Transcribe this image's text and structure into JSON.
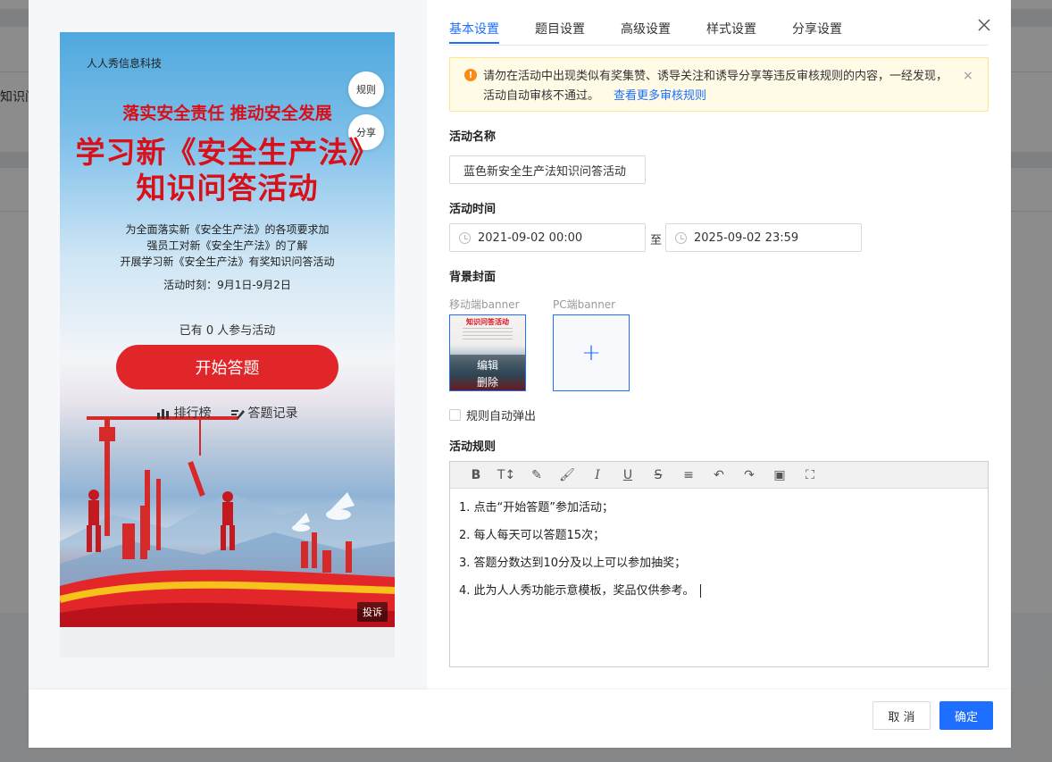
{
  "background": {
    "partial_text": "知识问"
  },
  "tabs": [
    {
      "label": "基本设置",
      "active": true
    },
    {
      "label": "题目设置"
    },
    {
      "label": "高级设置"
    },
    {
      "label": "样式设置"
    },
    {
      "label": "分享设置"
    }
  ],
  "close_icon": "close-icon",
  "notice": {
    "icon": "warning-icon",
    "text": "请勿在活动中出现类似有奖集赞、诱导关注和诱导分享等违反审核规则的内容，一经发现，活动自动审核不通过。",
    "link": "查看更多审核规则",
    "close": "×"
  },
  "form": {
    "name_label": "活动名称",
    "name_value": "蓝色新安全生产法知识问答活动",
    "time_label": "活动时间",
    "start_time": "2021-09-02 00:00",
    "to": "至",
    "end_time": "2025-09-02 23:59",
    "cover_label": "背景封面",
    "mobile_banner_label": "移动端banner",
    "pc_banner_label": "PC端banner",
    "thumb_title": "知识问答活动",
    "edit": "编辑",
    "delete": "删除",
    "upload_plus": "+",
    "auto_popup_label": "规则自动弹出",
    "auto_popup_checked": false,
    "rules_label": "活动规则"
  },
  "editor": {
    "toolbar": [
      "bold-icon",
      "font-size-icon",
      "highlight-icon",
      "brush-icon",
      "italic-icon",
      "underline-icon",
      "strikethrough-icon",
      "align-icon",
      "undo-icon",
      "redo-icon",
      "image-icon",
      "fullscreen-icon"
    ],
    "lines": [
      "1. 点击“开始答题”参加活动；",
      "2. 每人每天可以答题15次；",
      "3. 答题分数达到10分及以上可以参加抽奖；",
      "4. 此为人人秀功能示意模板，奖品仅供参考。"
    ]
  },
  "preview": {
    "company": "人人秀信息科技",
    "rules_btn": "规则",
    "share_btn": "分享",
    "slogan": "落实安全责任  推动安全发展",
    "title_line1": "学习新《安全生产法》",
    "title_line2": "知识问答活动",
    "desc": [
      "为全面落实新《安全生产法》的各项要求加",
      "强员工对新《安全生产法》的了解",
      "开展学习新《安全生产法》有奖知识问答活动"
    ],
    "time": "活动时刻：9月1日-9月2日",
    "participants": "已有 0 人参与活动",
    "start_button": "开始答题",
    "leaderboard": "排行榜",
    "records": "答题记录",
    "complain": "投诉"
  },
  "footer": {
    "cancel": "取 消",
    "ok": "确定"
  },
  "colors": {
    "primary": "#1e6fff",
    "poster_red": "#d8101a",
    "start_btn": "#e1262a",
    "notice_bg": "#fffbe6"
  }
}
